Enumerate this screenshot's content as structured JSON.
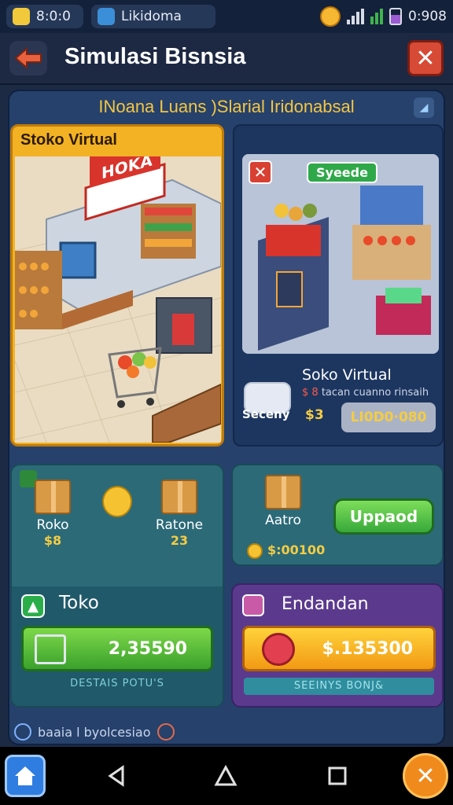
{
  "status_bar": {
    "app1_label": "8:0:0",
    "app2_label": "Likidoma",
    "time": "0:908"
  },
  "header": {
    "title": "Simulasi Bisnsia",
    "back_icon": "arrow-left-icon",
    "close_icon": "close-icon"
  },
  "banner": {
    "text": "INoana Luans )Slarial Iridonabsal"
  },
  "store_card": {
    "title": "Stoko Virtual",
    "sign": "HOKA"
  },
  "upgrade_card": {
    "badge": "Syeede",
    "name": "Soko Virtual",
    "subtitle_prefix": "$ 8",
    "subtitle": "tacan cuanno rinsaih",
    "left_label": "Seceny",
    "price": "$3",
    "button": "LI0D0·080"
  },
  "inventory_card": {
    "items": [
      {
        "label": "Roko",
        "value": "$8"
      },
      {
        "label": "",
        "value": ""
      },
      {
        "label": "Ratone",
        "value": "23"
      }
    ]
  },
  "upgrade_panel": {
    "label": "Aatro",
    "value": "$:00100",
    "button": "Uppaod"
  },
  "toko_panel": {
    "label": "Toko",
    "amount": "2,35590",
    "caption": "DESTAIS POTU'S"
  },
  "event_panel": {
    "label": "Endandan",
    "amount": "$.135300",
    "caption": "SEEINYS BONJ&"
  },
  "footnote": {
    "text": "baaia l byolcesiao"
  },
  "colors": {
    "background": "#1c2a44",
    "panel": "#26416b",
    "gold": "#f4c642",
    "green": "#3aa12c",
    "orange": "#f29a14",
    "purple": "#5b3a8e"
  }
}
